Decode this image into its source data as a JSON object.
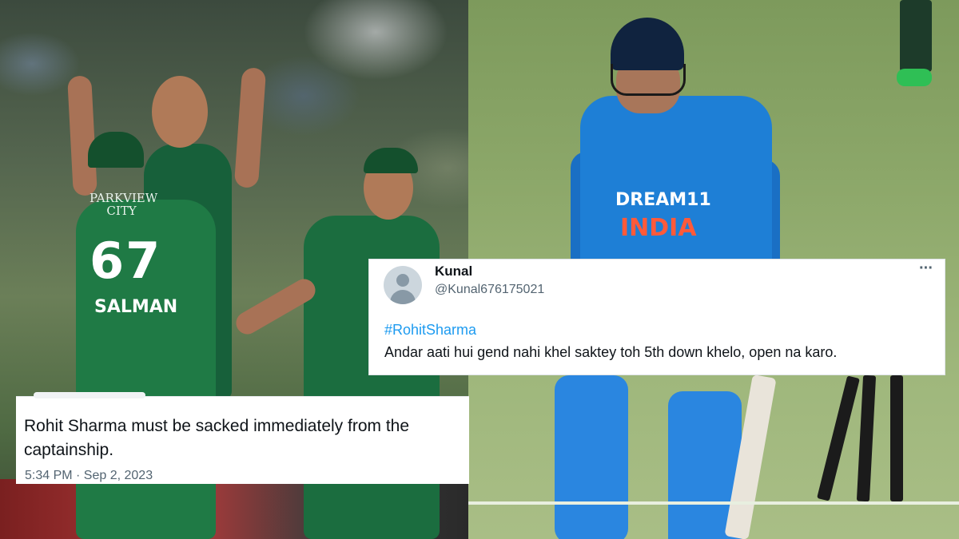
{
  "left_photo": {
    "jersey_number": "67",
    "jersey_name": "SALMAN",
    "jersey_sponsor": "PARKVIEW CITY"
  },
  "right_photo": {
    "jersey_sponsor": "DREAM11",
    "jersey_country": "INDIA"
  },
  "tweet_right": {
    "name": "Kunal",
    "handle": "@Kunal676175021",
    "more": "···",
    "hashtag": "#RohitSharma",
    "text": "Andar aati hui gend nahi khel saktey toh 5th down khelo, open na karo."
  },
  "tweet_left": {
    "text": "Rohit Sharma must be sacked immediately from the captainship.",
    "timestamp": "5:34 PM · Sep 2, 2023"
  }
}
